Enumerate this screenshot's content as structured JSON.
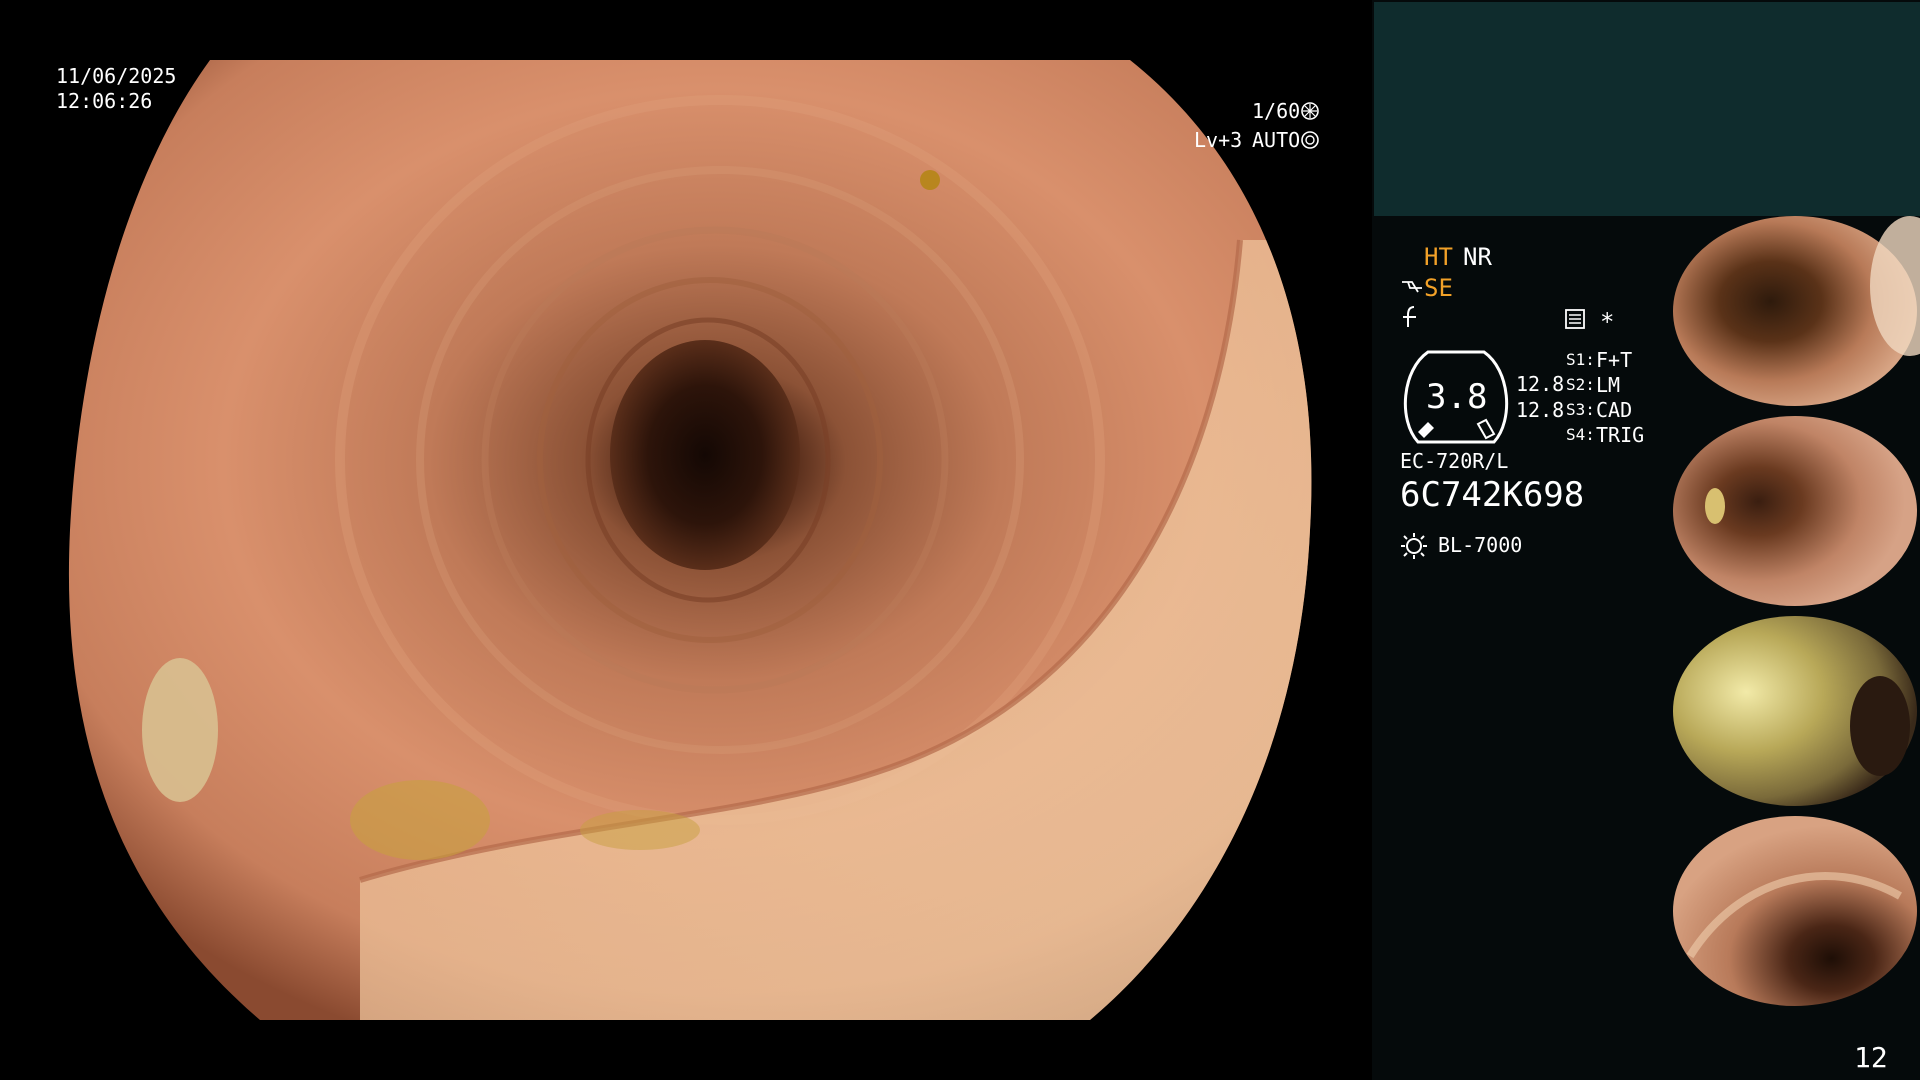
{
  "main": {
    "date": "11/06/2025",
    "time": "12:06:26",
    "shutter": "1/60",
    "level": "Lv+3",
    "iris_mode": "AUTO"
  },
  "panel": {
    "ht_label": "HT",
    "nr_label": "NR",
    "se_label": "SE",
    "asterisk": "*",
    "gauge_value": "3.8",
    "value_a": "12.8",
    "value_b": "12.8",
    "s_keys": [
      {
        "key": "S1:",
        "val": "F+T"
      },
      {
        "key": "S2:",
        "val": "LM"
      },
      {
        "key": "S3:",
        "val": "CAD"
      },
      {
        "key": "S4:",
        "val": "TRIG"
      }
    ],
    "scope_model": "EC-720R/L",
    "serial": "6C742K698",
    "light_source": "BL-7000",
    "page_number": "12"
  },
  "colors": {
    "panel_bg": "#050a0b",
    "teal_box": "#0f2c2d",
    "accent_orange": "#f2a128",
    "mucosa": "#d98e6a"
  },
  "icons": {
    "shutter": "shutter-icon",
    "iris": "iris-icon",
    "light": "light-bulb-icon",
    "menu": "menu-list-icon"
  },
  "thumbnails": {
    "count": 4
  }
}
